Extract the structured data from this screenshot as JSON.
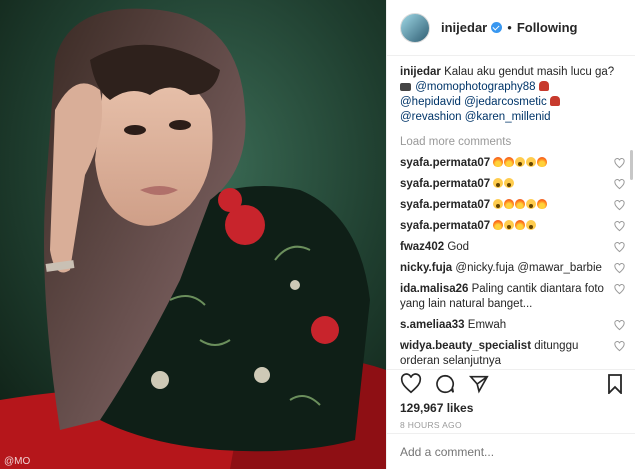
{
  "post": {
    "photo_watermark": "@MO"
  },
  "header": {
    "username": "inijedar",
    "separator": "•",
    "follow_status": "Following"
  },
  "caption": {
    "user": "inijedar",
    "text": "Kalau aku gendut masih lucu ga?",
    "mention_1": "@momophotography88",
    "mention_2": "@hepidavid",
    "mention_3": "@jedarcosmetic",
    "mention_4": "@revashion",
    "mention_5": "@karen_millenid"
  },
  "load_more": "Load more comments",
  "comments": [
    {
      "user": "syafa.permata07",
      "emojis": [
        "fire",
        "fire",
        "wow",
        "wow",
        "fire"
      ]
    },
    {
      "user": "syafa.permata07",
      "emojis": [
        "wow",
        "wow"
      ]
    },
    {
      "user": "syafa.permata07",
      "emojis": [
        "wow",
        "fire",
        "fire",
        "wow",
        "fire"
      ]
    },
    {
      "user": "syafa.permata07",
      "emojis": [
        "fire",
        "wow",
        "fire",
        "wow"
      ]
    },
    {
      "user": "fwaz402",
      "text": "God"
    },
    {
      "user": "nicky.fuja",
      "text": "@nicky.fuja @mawar_barbie"
    },
    {
      "user": "ida.malisa26",
      "text": "Paling cantik diantara foto yang lain natural banget..."
    },
    {
      "user": "s.ameliaa33",
      "text": "Emwah"
    },
    {
      "user": "widya.beauty_specialist",
      "text": "ditunggu orderan selanjutnya"
    }
  ],
  "likes": "129,967 likes",
  "timestamp": "8 HOURS AGO",
  "add_comment": {
    "placeholder": "Add a comment..."
  },
  "colors": {
    "accent": "#3897f0",
    "mention": "#003569",
    "muted": "#999999",
    "text": "#262626"
  }
}
